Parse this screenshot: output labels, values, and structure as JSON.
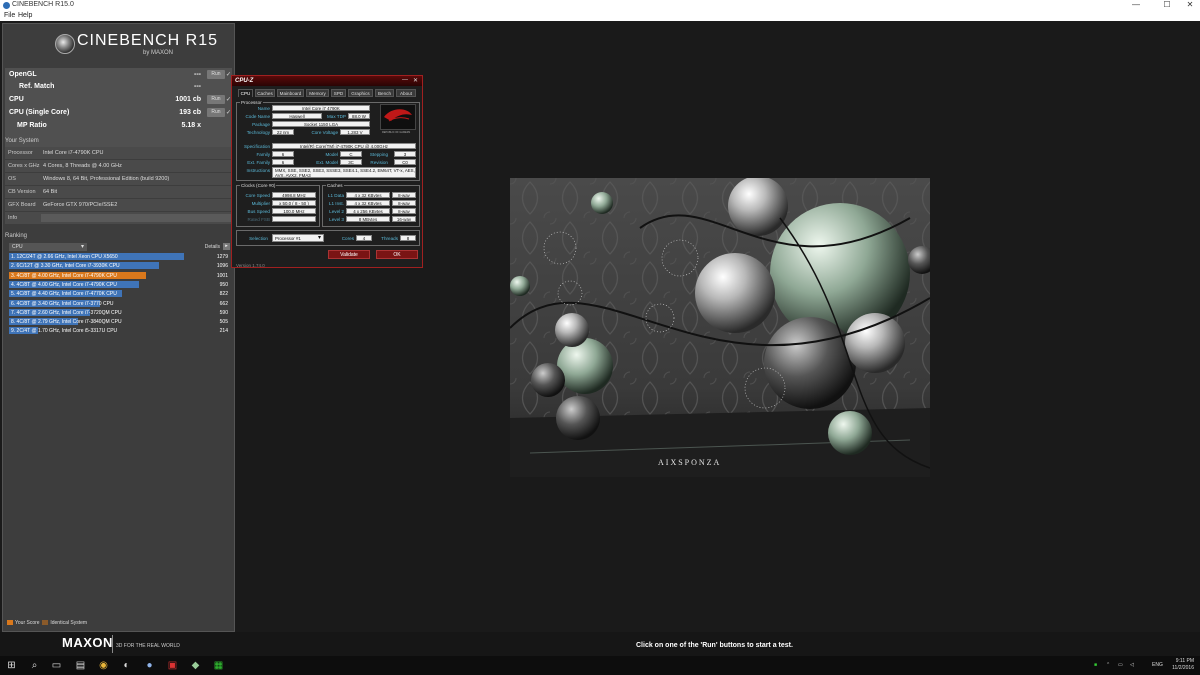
{
  "window": {
    "title": "CINEBENCH R15.0",
    "minimize": "—",
    "maximize": "☐",
    "close": "✕"
  },
  "menu": {
    "file": "File",
    "help": "Help"
  },
  "logo": {
    "name": "CINEBENCH R15",
    "by": "by MAXON"
  },
  "scores": [
    {
      "label": "OpenGL",
      "value": "---",
      "run": "Run",
      "check": "✓"
    },
    {
      "label": "Ref. Match",
      "value": "---"
    },
    {
      "label": "CPU",
      "value": "1001 cb",
      "run": "Run",
      "check": "✓"
    },
    {
      "label": "CPU (Single Core)",
      "value": "193 cb",
      "run": "Run",
      "check": "✓"
    },
    {
      "label": "MP Ratio",
      "value": "5.18 x"
    }
  ],
  "system": {
    "title": "Your System",
    "rows": [
      {
        "key": "Processor",
        "value": "Intel Core i7-4790K CPU"
      },
      {
        "key": "Cores x GHz",
        "value": "4 Cores, 8 Threads @ 4.00 GHz"
      },
      {
        "key": "OS",
        "value": "Windows 8, 64 Bit, Professional Edition (build 9200)"
      },
      {
        "key": "CB Version",
        "value": "64 Bit"
      },
      {
        "key": "GFX Board",
        "value": "GeForce GTX 970/PCIe/SSE2"
      },
      {
        "key": "Info",
        "value": ""
      }
    ]
  },
  "ranking": {
    "title": "Ranking",
    "select": "CPU",
    "details": "Details",
    "items": [
      {
        "label": "1. 12C/24T @ 2.66 GHz, Intel Xeon CPU X5650",
        "score": "1279",
        "value": 1279,
        "mine": false
      },
      {
        "label": "2. 6C/12T @ 3.30 GHz,  Intel Core i7-3930K CPU",
        "score": "1096",
        "value": 1096,
        "mine": false
      },
      {
        "label": "3. 4C/8T @ 4.00 GHz, Intel Core i7-4790K CPU",
        "score": "1001",
        "value": 1001,
        "mine": true
      },
      {
        "label": "4. 4C/8T @ 4.00 GHz, Intel Core i7-4790K CPU",
        "score": "950",
        "value": 950,
        "mine": false
      },
      {
        "label": "5. 4C/8T @ 4.40 GHz, Intel Core i7-4770K CPU",
        "score": "822",
        "value": 822,
        "mine": false
      },
      {
        "label": "6. 4C/8T @ 3.40 GHz,  Intel Core i7-3770 CPU",
        "score": "662",
        "value": 662,
        "mine": false
      },
      {
        "label": "7. 4C/8T @ 2.60 GHz, Intel Core i7-3720QM CPU",
        "score": "590",
        "value": 590,
        "mine": false
      },
      {
        "label": "8. 4C/8T @ 2.79 GHz,  Intel Core i7-3840QM CPU",
        "score": "505",
        "value": 505,
        "mine": false
      },
      {
        "label": "9. 2C/4T @ 1.70 GHz,  Intel Core i5-3317U CPU",
        "score": "214",
        "value": 214,
        "mine": false
      }
    ],
    "max": 1279
  },
  "legend": {
    "your_score": "Your Score",
    "identical": "Identical System"
  },
  "colors": {
    "your_score": "#d9781c",
    "identical": "#8a5a2a",
    "bar": "#3f74b8"
  },
  "footer": {
    "brand": "MAXON",
    "slogan": "3D FOR THE REAL WORLD",
    "status": "Click on one of the 'Run' buttons to start a test."
  },
  "render": {
    "watermark": "AIXSPONZA"
  },
  "cpuz": {
    "title": "CPU-Z",
    "tabs": [
      "CPU",
      "Caches",
      "Mainboard",
      "Memory",
      "SPD",
      "Graphics",
      "Bench",
      "About"
    ],
    "processor_title": "Processor",
    "name_label": "Name",
    "name": "Intel Core i7 4790K",
    "codename_label": "Code Name",
    "codename": "Haswell",
    "maxtdp_label": "Max TDP",
    "maxtdp": "88.0 W",
    "package_label": "Package",
    "package": "Socket 1150 LGA",
    "technology_label": "Technology",
    "technology": "22 nm",
    "voltage_label": "Core Voltage",
    "voltage": "1.283 V",
    "spec_label": "Specification",
    "spec": "Intel(R) Core(TM) i7-4790K CPU @ 4.00GHz",
    "family_label": "Family",
    "family": "6",
    "model_label": "Model",
    "model": "C",
    "stepping_label": "Stepping",
    "stepping": "3",
    "extfamily_label": "Ext. Family",
    "extfamily": "6",
    "extmodel_label": "Ext. Model",
    "extmodel": "3C",
    "revision_label": "Revision",
    "revision": "C0",
    "instr_label": "Instructions",
    "instr": "MMX, SSE, SSE2, SSE3, SSSE3, SSE4.1, SSE4.2, EM64T, VT-x, AES, AVX, AVX2, FMA3",
    "clocks_title": "Clocks (Core #0)",
    "corespeed_label": "Core Speed",
    "corespeed": "4998.8 MHz",
    "multiplier_label": "Multiplier",
    "multiplier": "x 50.0 ( 8 - 50 )",
    "busspeed_label": "Bus Speed",
    "busspeed": "100.0 MHz",
    "ratedfsb_label": "Rated FSB",
    "ratedfsb": "",
    "caches_title": "Caches",
    "l1d_label": "L1 Data",
    "l1d": "4 x 32 KBytes",
    "l1d_way": "8-way",
    "l1i_label": "L1 Inst.",
    "l1i": "4 x 32 KBytes",
    "l1i_way": "8-way",
    "l2_label": "Level 2",
    "l2": "4 x 256 KBytes",
    "l2_way": "8-way",
    "l3_label": "Level 3",
    "l3": "8 MBytes",
    "l3_way": "16-way",
    "selection_label": "Selection",
    "selection": "Processor #1",
    "cores_label": "Cores",
    "cores": "4",
    "threads_label": "Threads",
    "threads": "8",
    "validate": "Validate",
    "ok": "OK",
    "version": "Version 1.74.0",
    "rog_text": "REPUBLIC OF GAMERS"
  },
  "taskbar": {
    "time": "9:11 PM",
    "date": "11/2/2016",
    "lang": "ENG"
  }
}
